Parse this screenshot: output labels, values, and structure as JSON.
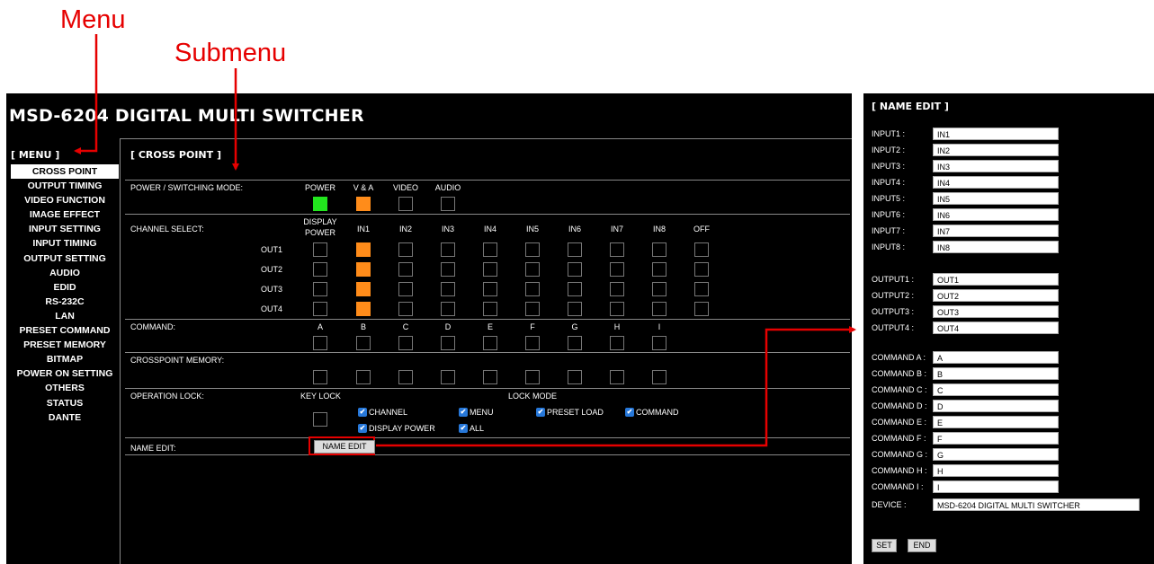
{
  "annotations": {
    "menu": "Menu",
    "submenu": "Submenu"
  },
  "app": {
    "title": "MSD-6204 DIGITAL MULTI SWITCHER"
  },
  "menu": {
    "header": "[ MENU ]",
    "active": "CROSS POINT",
    "items": [
      "CROSS POINT",
      "OUTPUT TIMING",
      "VIDEO FUNCTION",
      "IMAGE EFFECT",
      "INPUT SETTING",
      "INPUT TIMING",
      "OUTPUT SETTING",
      "AUDIO",
      "EDID",
      "RS-232C",
      "LAN",
      "PRESET COMMAND",
      "PRESET MEMORY",
      "BITMAP",
      "POWER ON SETTING",
      "OTHERS",
      "STATUS",
      "DANTE"
    ]
  },
  "cross_point": {
    "header": "[ CROSS POINT ]",
    "power_mode": {
      "label": "POWER / SWITCHING MODE:",
      "options": [
        "POWER",
        "V & A",
        "VIDEO",
        "AUDIO"
      ],
      "states": [
        "green",
        "orange",
        "off",
        "off"
      ]
    },
    "channel_select": {
      "label": "CHANNEL SELECT:",
      "display_power": [
        "DISPLAY",
        "POWER"
      ],
      "inputs": [
        "IN1",
        "IN2",
        "IN3",
        "IN4",
        "IN5",
        "IN6",
        "IN7",
        "IN8",
        "OFF"
      ],
      "outputs": [
        "OUT1",
        "OUT2",
        "OUT3",
        "OUT4"
      ],
      "selected_input_index": 0
    },
    "command": {
      "label": "COMMAND:",
      "keys": [
        "A",
        "B",
        "C",
        "D",
        "E",
        "F",
        "G",
        "H",
        "I"
      ]
    },
    "crosspoint_memory": {
      "label": "CROSSPOINT MEMORY:",
      "count": 9
    },
    "operation_lock": {
      "label": "OPERATION LOCK:",
      "key_lock": "KEY LOCK",
      "lock_mode": "LOCK MODE",
      "checks_row1": [
        "CHANNEL",
        "MENU",
        "PRESET LOAD",
        "COMMAND"
      ],
      "checks_row2": [
        "DISPLAY POWER",
        "ALL"
      ]
    },
    "name_edit": {
      "label": "NAME EDIT:",
      "button": "NAME EDIT"
    }
  },
  "name_edit_panel": {
    "title": "[ NAME EDIT ]",
    "inputs": [
      {
        "label": "INPUT1 :",
        "value": "IN1"
      },
      {
        "label": "INPUT2 :",
        "value": "IN2"
      },
      {
        "label": "INPUT3 :",
        "value": "IN3"
      },
      {
        "label": "INPUT4 :",
        "value": "IN4"
      },
      {
        "label": "INPUT5 :",
        "value": "IN5"
      },
      {
        "label": "INPUT6 :",
        "value": "IN6"
      },
      {
        "label": "INPUT7 :",
        "value": "IN7"
      },
      {
        "label": "INPUT8 :",
        "value": "IN8"
      }
    ],
    "outputs": [
      {
        "label": "OUTPUT1 :",
        "value": "OUT1"
      },
      {
        "label": "OUTPUT2 :",
        "value": "OUT2"
      },
      {
        "label": "OUTPUT3 :",
        "value": "OUT3"
      },
      {
        "label": "OUTPUT4 :",
        "value": "OUT4"
      }
    ],
    "commands": [
      {
        "label": "COMMAND A :",
        "value": "A"
      },
      {
        "label": "COMMAND B :",
        "value": "B"
      },
      {
        "label": "COMMAND C :",
        "value": "C"
      },
      {
        "label": "COMMAND D :",
        "value": "D"
      },
      {
        "label": "COMMAND E :",
        "value": "E"
      },
      {
        "label": "COMMAND F :",
        "value": "F"
      },
      {
        "label": "COMMAND G :",
        "value": "G"
      },
      {
        "label": "COMMAND H :",
        "value": "H"
      },
      {
        "label": "COMMAND I :",
        "value": "I"
      }
    ],
    "device": {
      "label": "DEVICE :",
      "value": "MSD-6204 DIGITAL MULTI SWITCHER"
    },
    "set_button": "SET",
    "end_button": "END"
  },
  "colors": {
    "power_on": "#22e61e",
    "selected": "#ff8c1a",
    "annotation": "#e60000",
    "checkbox": "#2778d9"
  }
}
